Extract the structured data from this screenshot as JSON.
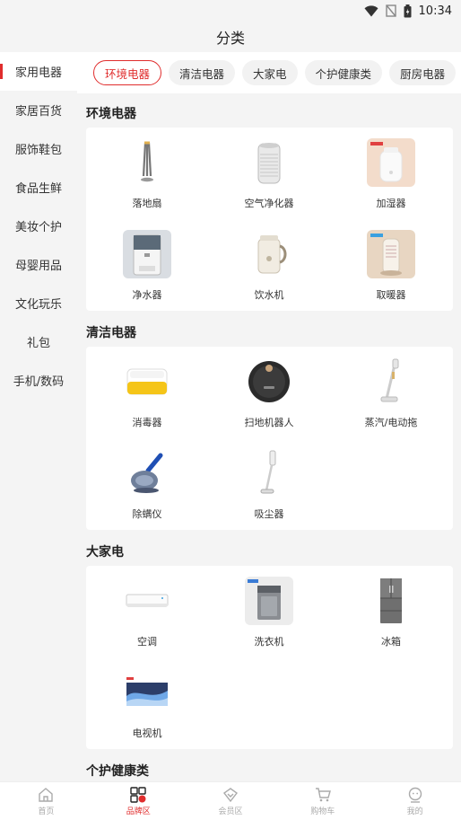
{
  "status_bar": {
    "time": "10:34",
    "icons": [
      "wifi-icon",
      "signal-icon",
      "battery-icon"
    ]
  },
  "header": {
    "title": "分类"
  },
  "sidebar": {
    "active_index": 0,
    "items": [
      {
        "label": "家用电器"
      },
      {
        "label": "家居百货"
      },
      {
        "label": "服饰鞋包"
      },
      {
        "label": "食品生鲜"
      },
      {
        "label": "美妆个护"
      },
      {
        "label": "母婴用品"
      },
      {
        "label": "文化玩乐"
      },
      {
        "label": "礼包"
      },
      {
        "label": "手机/数码"
      }
    ]
  },
  "subcategory_tabs": {
    "active_index": 0,
    "items": [
      {
        "label": "环境电器"
      },
      {
        "label": "清洁电器"
      },
      {
        "label": "大家电"
      },
      {
        "label": "个护健康类"
      },
      {
        "label": "厨房电器"
      }
    ]
  },
  "sections": [
    {
      "title": "环境电器",
      "items": [
        {
          "label": "落地扇",
          "icon": "floor-fan-icon"
        },
        {
          "label": "空气净化器",
          "icon": "air-purifier-icon"
        },
        {
          "label": "加湿器",
          "icon": "humidifier-icon"
        },
        {
          "label": "净水器",
          "icon": "water-purifier-icon"
        },
        {
          "label": "饮水机",
          "icon": "water-dispenser-icon"
        },
        {
          "label": "取暖器",
          "icon": "heater-icon"
        }
      ]
    },
    {
      "title": "清洁电器",
      "items": [
        {
          "label": "消毒器",
          "icon": "sterilizer-icon"
        },
        {
          "label": "扫地机器人",
          "icon": "robot-vacuum-icon"
        },
        {
          "label": "蒸汽/电动拖",
          "icon": "steam-mop-icon"
        },
        {
          "label": "除螨仪",
          "icon": "mite-remover-icon"
        },
        {
          "label": "吸尘器",
          "icon": "vacuum-cleaner-icon"
        }
      ]
    },
    {
      "title": "大家电",
      "items": [
        {
          "label": "空调",
          "icon": "air-conditioner-icon"
        },
        {
          "label": "洗衣机",
          "icon": "washing-machine-icon"
        },
        {
          "label": "冰箱",
          "icon": "refrigerator-icon"
        },
        {
          "label": "电视机",
          "icon": "television-icon"
        }
      ]
    },
    {
      "title": "个护健康类",
      "items": []
    }
  ],
  "bottom_tabs": {
    "active_index": 1,
    "items": [
      {
        "label": "首页",
        "icon": "home-icon"
      },
      {
        "label": "品牌区",
        "icon": "brand-grid-icon"
      },
      {
        "label": "会员区",
        "icon": "member-icon"
      },
      {
        "label": "购物车",
        "icon": "cart-icon"
      },
      {
        "label": "我的",
        "icon": "profile-icon"
      }
    ]
  },
  "colors": {
    "accent": "#e02d2d",
    "background": "#f4f4f4",
    "card": "#ffffff"
  }
}
